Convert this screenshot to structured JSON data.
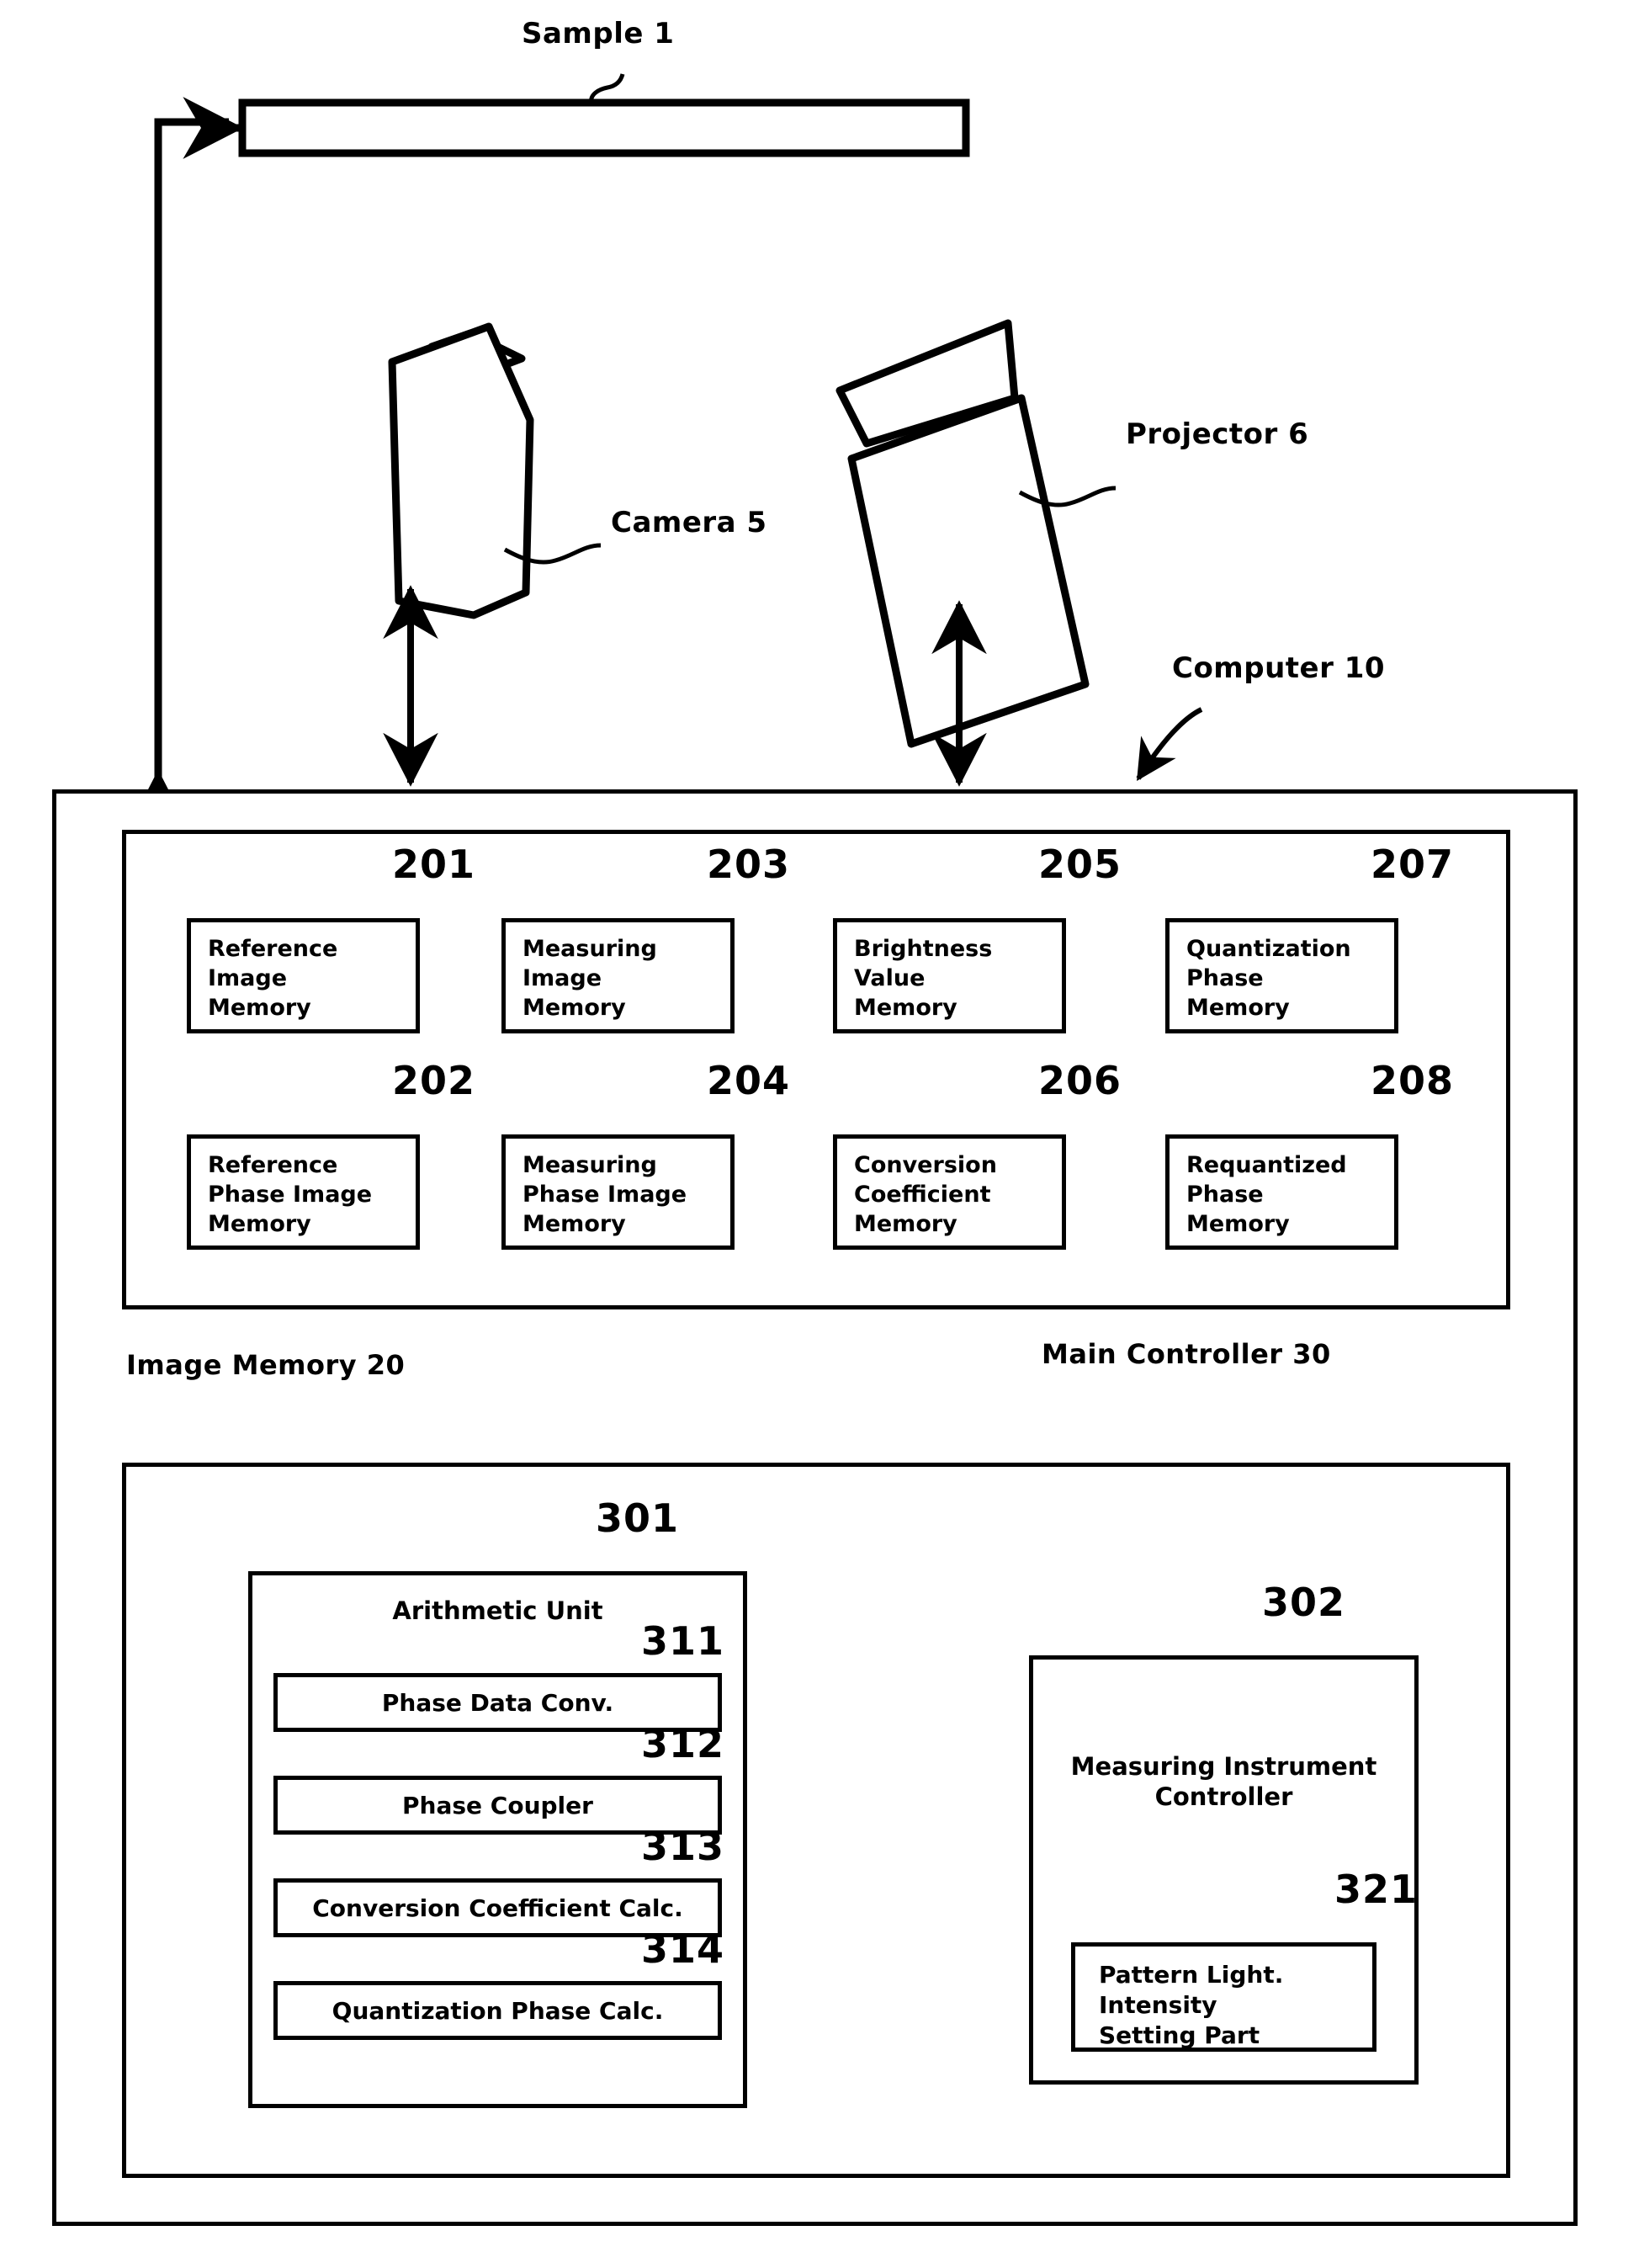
{
  "figure": {
    "sample": {
      "label": "Sample 1"
    },
    "camera": {
      "label": "Camera 5"
    },
    "projector": {
      "label": "Projector 6"
    },
    "computer": {
      "label": "Computer 10"
    },
    "image_memory": {
      "label": "Image Memory 20",
      "cells": [
        {
          "ref": "201",
          "text_line1": "Reference",
          "text_line2": "Image",
          "text_line3": "Memory"
        },
        {
          "ref": "203",
          "text_line1": "Measuring",
          "text_line2": "Image",
          "text_line3": "Memory"
        },
        {
          "ref": "205",
          "text_line1": "Brightness",
          "text_line2": "Value",
          "text_line3": "Memory"
        },
        {
          "ref": "207",
          "text_line1": "Quantization",
          "text_line2": "Phase",
          "text_line3": "Memory"
        },
        {
          "ref": "202",
          "text_line1": "Reference",
          "text_line2": "Phase Image",
          "text_line3": "Memory"
        },
        {
          "ref": "204",
          "text_line1": "Measuring",
          "text_line2": "Phase Image",
          "text_line3": "Memory"
        },
        {
          "ref": "206",
          "text_line1": "Conversion",
          "text_line2": "Coefficient",
          "text_line3": "Memory"
        },
        {
          "ref": "208",
          "text_line1": "Requantized",
          "text_line2": "Phase",
          "text_line3": "Memory"
        }
      ]
    },
    "main_controller": {
      "label": "Main Controller 30",
      "arithmetic_unit": {
        "ref": "301",
        "title": "Arithmetic Unit",
        "units": [
          {
            "ref": "311",
            "label": "Phase Data Conv."
          },
          {
            "ref": "312",
            "label": "Phase Coupler"
          },
          {
            "ref": "313",
            "label": "Conversion Coefficient Calc."
          },
          {
            "ref": "314",
            "label": "Quantization Phase Calc."
          }
        ]
      },
      "instrument_controller": {
        "ref": "302",
        "title_line1": "Measuring Instrument",
        "title_line2": "Controller",
        "parts": [
          {
            "ref": "321",
            "text_line1": "Pattern Light.",
            "text_line2": "Intensity",
            "text_line3": "Setting Part"
          }
        ]
      }
    },
    "colors": {
      "ink": "#000000",
      "paper": "#ffffff"
    }
  }
}
